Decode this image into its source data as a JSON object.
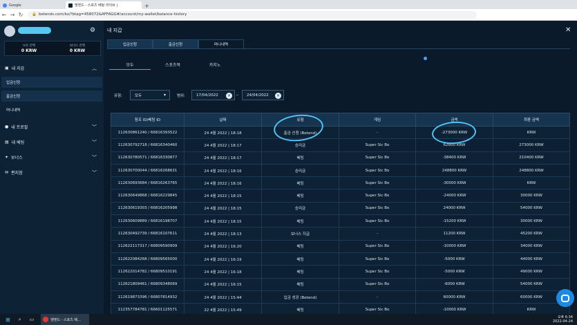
{
  "browser": {
    "tabs": [
      {
        "label": "Google"
      },
      {
        "label": "벳엔드 - 스포츠 베팅 라이브 |"
      }
    ],
    "url": "betends.com/ko/?btag=458072&AFFAGG#/account/my-wallet/balance-history"
  },
  "sidebar": {
    "username": "",
    "balance_label": "보유 잔액",
    "balance": "0 KRW",
    "bonus_label": "보너스 잔액",
    "bonus": "0 KRW",
    "items": [
      {
        "label": "내 지갑"
      },
      {
        "label": "입금신청"
      },
      {
        "label": "출금신청"
      },
      {
        "label": "머니내역"
      },
      {
        "label": "내 프로필"
      },
      {
        "label": "내 베팅"
      },
      {
        "label": "보너스"
      },
      {
        "label": "편지함"
      }
    ]
  },
  "content": {
    "title": "내 지갑",
    "tabs": [
      "입금신청",
      "출금신청",
      "머니내역"
    ],
    "subtabs": [
      "모두",
      "스포츠북",
      "카지노"
    ],
    "type_label": "유형:",
    "type_value": "모두",
    "range_label": "범위:",
    "date_from": "17/04/2022",
    "date_to": "24/04/2022",
    "dash": "–"
  },
  "table": {
    "headers": [
      "참조 ID/베팅 ID",
      "날짜",
      "유형",
      "게임",
      "금액",
      "최종 금액"
    ],
    "rows": [
      [
        "112630861240 / 66816393522",
        "24 4월 2022 | 18:18",
        "출금 신청 (Betend)",
        "-",
        "-273000 KRW",
        "KRW"
      ],
      [
        "112630792718 / 66816340460",
        "24 4월 2022 | 18:17",
        "승리금",
        "Super Sic Bo",
        "62600 KRW",
        "273000 KRW"
      ],
      [
        "112630780571 / 66816330877",
        "24 4월 2022 | 18:17",
        "베팅",
        "Super Sic Bo",
        "-38400 KRW",
        "210400 KRW"
      ],
      [
        "112630700044 / 66816268631",
        "24 4월 2022 | 18:16",
        "승리금",
        "Super Sic Bo",
        "248800 KRW",
        "248800 KRW"
      ],
      [
        "112630693684 / 66816263765",
        "24 4월 2022 | 18:16",
        "베팅",
        "Super Sic Bo",
        "-30000 KRW",
        "KRW"
      ],
      [
        "112630649868 / 66816229845",
        "24 4월 2022 | 18:15",
        "베팅",
        "Super Sic Bo",
        "-24000 KRW",
        "30000 KRW"
      ],
      [
        "112630619303 / 66816205998",
        "24 4월 2022 | 18:15",
        "승리금",
        "Super Sic Bo",
        "24000 KRW",
        "54000 KRW"
      ],
      [
        "112630609889 / 66816198707",
        "24 4월 2022 | 18:15",
        "베팅",
        "Super Sic Bo",
        "-15200 KRW",
        "30000 KRW"
      ],
      [
        "112630492739 / 66816107611",
        "24 4월 2022 | 18:13",
        "보너스 지급",
        "-",
        "11200 KRW",
        "45200 KRW"
      ],
      [
        "112622117317 / 66809590909",
        "24 4월 2022 | 16:20",
        "베팅",
        "Super Sic Bo",
        "-10000 KRW",
        "34000 KRW"
      ],
      [
        "112622084268 / 66809565000",
        "24 4월 2022 | 16:19",
        "베팅",
        "Super Sic Bo",
        "-5000 KRW",
        "44000 KRW"
      ],
      [
        "112622014782 / 66809510191",
        "24 4월 2022 | 16:18",
        "베팅",
        "Super Sic Bo",
        "-5000 KRW",
        "49000 KRW"
      ],
      [
        "112621809461 / 66809348069",
        "24 4월 2022 | 16:15",
        "베팅",
        "Super Sic Bo",
        "-6000 KRW",
        "54000 KRW"
      ],
      [
        "112619873396 / 66807814932",
        "24 4월 2022 | 15:44",
        "입금 성공 (Betend)",
        "-",
        "60000 KRW",
        "60000 KRW"
      ],
      [
        "112357784781 / 66601125571",
        "22 4월 2022 | 15:49",
        "베팅",
        "Super Sic Bo",
        "-10000 KRW",
        "KRW"
      ]
    ]
  },
  "taskbar": {
    "search_placeholder": "",
    "app_label": "벳엔드 - 스포츠 베...",
    "time": "오후 6:34",
    "date": "2022-04-24"
  }
}
